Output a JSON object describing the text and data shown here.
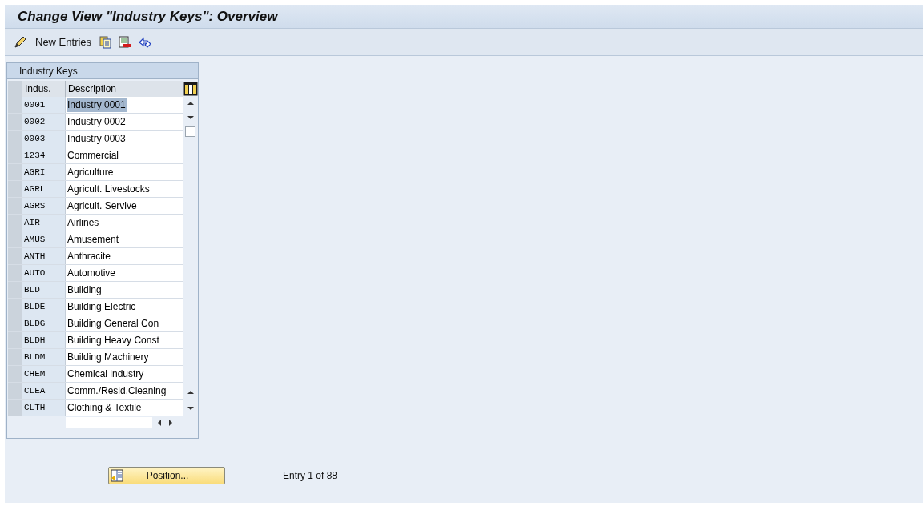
{
  "title": "Change View \"Industry Keys\": Overview",
  "toolbar": {
    "new_entries": "New Entries"
  },
  "table": {
    "title": "Industry Keys",
    "columns": [
      "Indus.",
      "Description"
    ],
    "rows": [
      {
        "key": "0001",
        "description": "Industry 0001",
        "selected": true
      },
      {
        "key": "0002",
        "description": "Industry 0002",
        "selected": false
      },
      {
        "key": "0003",
        "description": "Industry 0003",
        "selected": false
      },
      {
        "key": "1234",
        "description": "Commercial",
        "selected": false
      },
      {
        "key": "AGRI",
        "description": "Agriculture",
        "selected": false
      },
      {
        "key": "AGRL",
        "description": "Agricult. Livestocks",
        "selected": false
      },
      {
        "key": "AGRS",
        "description": "Agricult. Servive",
        "selected": false
      },
      {
        "key": "AIR",
        "description": "Airlines",
        "selected": false
      },
      {
        "key": "AMUS",
        "description": "Amusement",
        "selected": false
      },
      {
        "key": "ANTH",
        "description": "Anthracite",
        "selected": false
      },
      {
        "key": "AUTO",
        "description": "Automotive",
        "selected": false
      },
      {
        "key": "BLD",
        "description": "Building",
        "selected": false
      },
      {
        "key": "BLDE",
        "description": "Building Electric",
        "selected": false
      },
      {
        "key": "BLDG",
        "description": "Building General Con",
        "selected": false
      },
      {
        "key": "BLDH",
        "description": "Building Heavy Const",
        "selected": false
      },
      {
        "key": "BLDM",
        "description": "Building Machinery",
        "selected": false
      },
      {
        "key": "CHEM",
        "description": "Chemical industry",
        "selected": false
      },
      {
        "key": "CLEA",
        "description": "Comm./Resid.Cleaning",
        "selected": false
      },
      {
        "key": "CLTH",
        "description": "Clothing & Textile",
        "selected": false
      }
    ]
  },
  "position_button": "Position...",
  "entry_info": "Entry 1 of 88"
}
